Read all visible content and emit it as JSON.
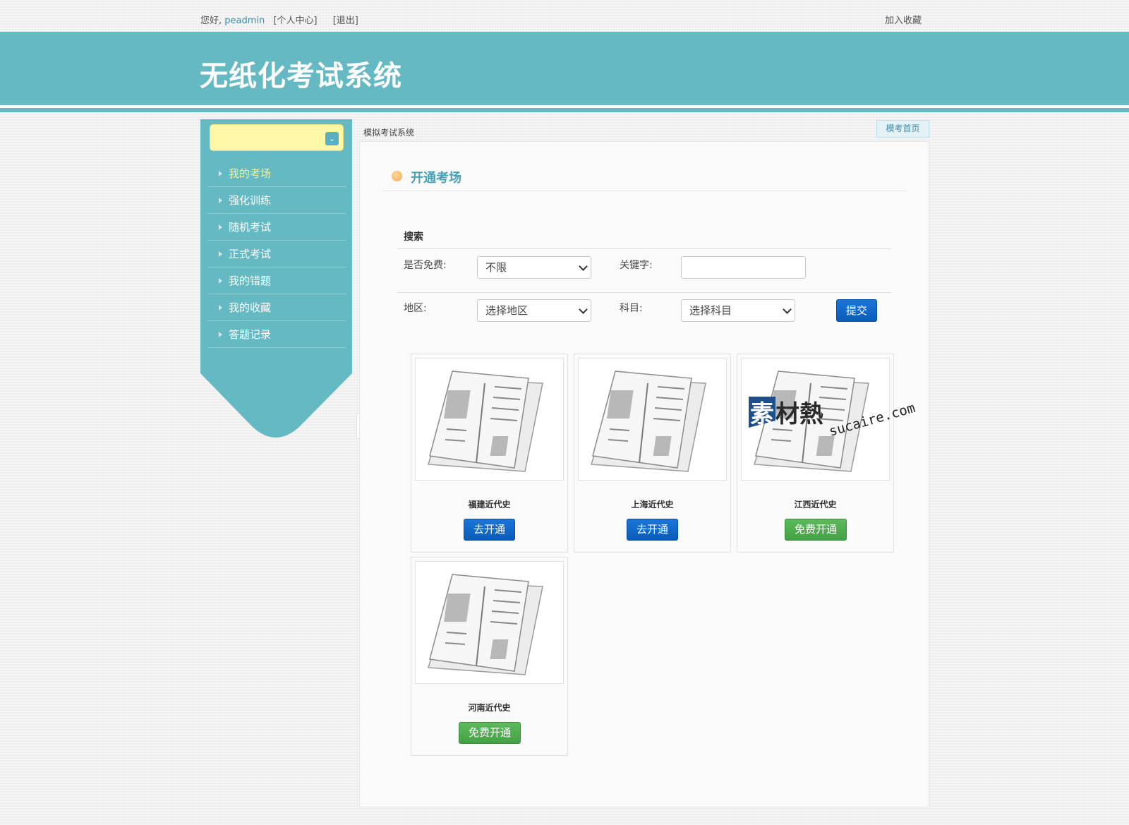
{
  "topbar": {
    "greeting": "您好,",
    "username": "peadmin",
    "personal_center": "[个人中心]",
    "logout": "[退出]",
    "favorite": "加入收藏"
  },
  "header": {
    "title": "无纸化考试系统"
  },
  "sidebar": {
    "select_value": "",
    "items": [
      {
        "label": "我的考场",
        "active": true
      },
      {
        "label": "强化训练",
        "active": false
      },
      {
        "label": "随机考试",
        "active": false
      },
      {
        "label": "正式考试",
        "active": false
      },
      {
        "label": "我的错题",
        "active": false
      },
      {
        "label": "我的收藏",
        "active": false
      },
      {
        "label": "答题记录",
        "active": false
      }
    ]
  },
  "breadcrumb": "模拟考试系统",
  "home_tab": "模考首页",
  "section_title": "开通考场",
  "search": {
    "heading": "搜索",
    "free_label": "是否免费:",
    "free_value": "不限",
    "keyword_label": "关键字:",
    "keyword_value": "",
    "region_label": "地区:",
    "region_value": "选择地区",
    "subject_label": "科目:",
    "subject_value": "选择科目",
    "submit": "提交"
  },
  "exams": [
    {
      "name": "福建近代史",
      "button": "去开通",
      "type": "blue"
    },
    {
      "name": "上海近代史",
      "button": "去开通",
      "type": "blue"
    },
    {
      "name": "江西近代史",
      "button": "免费开通",
      "type": "green"
    },
    {
      "name": "河南近代史",
      "button": "免费开通",
      "type": "green"
    }
  ],
  "watermark": {
    "cn": "素材熱",
    "en": "sucaire.com"
  },
  "colors": {
    "header": "#64b9c3",
    "accent_blue": "#0a5cb8",
    "accent_green": "#44a044",
    "active_menu": "#f4f39a"
  }
}
